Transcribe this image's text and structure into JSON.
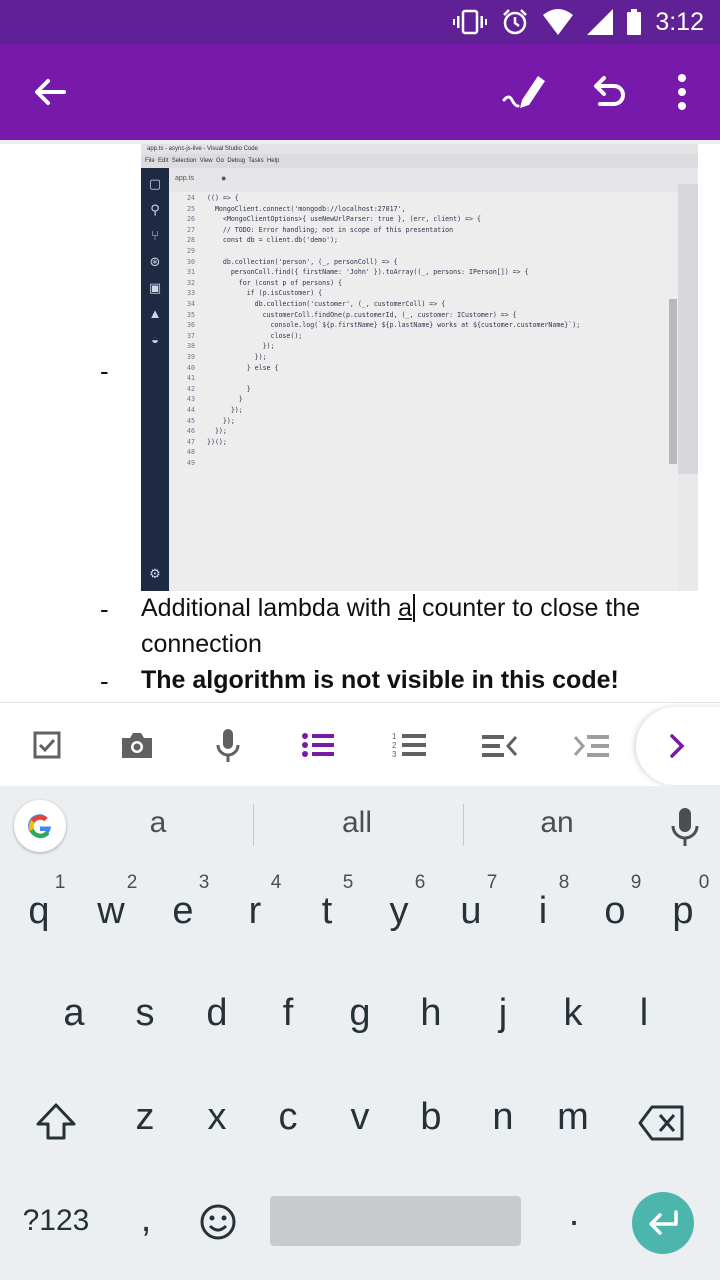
{
  "status_bar": {
    "time": "3:12"
  },
  "app_bar": {
    "back_icon": "arrow-left-icon",
    "pen_icon": "draw-pen-icon",
    "undo_icon": "undo-icon",
    "more_icon": "more-vert-icon"
  },
  "screenshot": {
    "window_title": "app.ts - async-js-live - Visual Studio Code",
    "menu": [
      "File",
      "Edit",
      "Selection",
      "View",
      "Go",
      "Debug",
      "Tasks",
      "Help"
    ],
    "tab": "app.ts",
    "code_lines": [
      {
        "num": "24",
        "text": "(() => {"
      },
      {
        "num": "25",
        "text": "  MongoClient.connect('mongodb://localhost:27017',"
      },
      {
        "num": "26",
        "text": "    <MongoClientOptions>{ useNewUrlParser: true }, (err, client) => {"
      },
      {
        "num": "27",
        "text": "    // TODO: Error handling; not in scope of this presentation"
      },
      {
        "num": "28",
        "text": "    const db = client.db('demo');"
      },
      {
        "num": "29",
        "text": ""
      },
      {
        "num": "30",
        "text": "    db.collection('person', (_, personColl) => {"
      },
      {
        "num": "31",
        "text": "      personColl.find({ firstName: 'John' }).toArray((_, persons: IPerson[]) => {"
      },
      {
        "num": "32",
        "text": "        for (const p of persons) {"
      },
      {
        "num": "33",
        "text": "          if (p.isCustomer) {"
      },
      {
        "num": "34",
        "text": "            db.collection('customer', (_, customerColl) => {"
      },
      {
        "num": "35",
        "text": "              customerColl.findOne(p.customerId, (_, customer: ICustomer) => {"
      },
      {
        "num": "36",
        "text": "                console.log(`${p.firstName} ${p.lastName} works at ${customer.customerName}`);"
      },
      {
        "num": "37",
        "text": "                close();"
      },
      {
        "num": "38",
        "text": "              });"
      },
      {
        "num": "39",
        "text": "            });"
      },
      {
        "num": "40",
        "text": "          } else {"
      },
      {
        "num": "41",
        "text": ""
      },
      {
        "num": "42",
        "text": "          }"
      },
      {
        "num": "43",
        "text": "        }"
      },
      {
        "num": "44",
        "text": "      });"
      },
      {
        "num": "45",
        "text": "    });"
      },
      {
        "num": "46",
        "text": "  });"
      },
      {
        "num": "47",
        "text": "})();"
      },
      {
        "num": "48",
        "text": ""
      },
      {
        "num": "49",
        "text": ""
      }
    ]
  },
  "note": {
    "line1": "Additional lambda with ",
    "line1_cursor_char": "a",
    "line1_rest": " counter to close the",
    "line2": "connection",
    "line3": "The algorithm is not visible in this code!"
  },
  "format_bar": {
    "icons": [
      "checkbox-icon",
      "camera-icon",
      "microphone-icon",
      "bullet-list-icon",
      "numbered-list-icon",
      "outdent-icon",
      "indent-icon",
      "chevron-right-icon"
    ]
  },
  "keyboard": {
    "suggestions": [
      "a",
      "all",
      "an"
    ],
    "row1": [
      "q",
      "w",
      "e",
      "r",
      "t",
      "y",
      "u",
      "i",
      "o",
      "p"
    ],
    "row1_hints": [
      "1",
      "2",
      "3",
      "4",
      "5",
      "6",
      "7",
      "8",
      "9",
      "0"
    ],
    "row2": [
      "a",
      "s",
      "d",
      "f",
      "g",
      "h",
      "j",
      "k",
      "l"
    ],
    "row3": [
      "z",
      "x",
      "c",
      "v",
      "b",
      "n",
      "m"
    ],
    "symbols_label": "?123",
    "comma": ",",
    "period": "."
  },
  "colors": {
    "status_bar": "#5f2195",
    "app_bar": "#7719aa",
    "accent": "#7719aa",
    "enter_key": "#4db6ac"
  }
}
